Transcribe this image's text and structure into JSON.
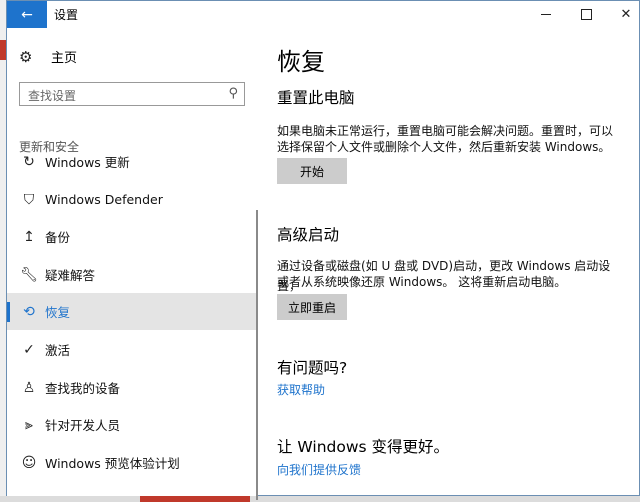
{
  "window": {
    "title": "设置",
    "back_icon": "arrow-left-icon"
  },
  "sidebar": {
    "home_label": "主页",
    "search_placeholder": "查找设置",
    "section_title": "更新和安全",
    "items": [
      {
        "label": "Windows 更新",
        "icon": "sync-icon"
      },
      {
        "label": "Windows Defender",
        "icon": "shield-icon"
      },
      {
        "label": "备份",
        "icon": "upload-arrow-icon"
      },
      {
        "label": "疑难解答",
        "icon": "wrench-icon"
      },
      {
        "label": "恢复",
        "icon": "history-icon",
        "active": true
      },
      {
        "label": "激活",
        "icon": "check-circle-icon"
      },
      {
        "label": "查找我的设备",
        "icon": "person-icon"
      },
      {
        "label": "针对开发人员",
        "icon": "developer-icon"
      },
      {
        "label": "Windows 预览体验计划",
        "icon": "smiley-icon"
      }
    ]
  },
  "content": {
    "page_title": "恢复",
    "reset": {
      "heading": "重置此电脑",
      "line1": "如果电脑未正常运行，重置电脑可能会解决问题。重置时，可以",
      "line2": "选择保留个人文件或删除个人文件，然后重新安装 Windows。",
      "button": "开始"
    },
    "advanced": {
      "heading": "高级启动",
      "line1": "通过设备或磁盘(如 U 盘或 DVD)启动，更改 Windows 启动设置，",
      "line2": "或者从系统映像还原 Windows。 这将重新启动电脑。",
      "button": "立即重启"
    },
    "question": {
      "heading": "有问题吗?",
      "link": "获取帮助"
    },
    "better": {
      "heading": "让 Windows 变得更好。",
      "link": "向我们提供反馈"
    }
  },
  "colors": {
    "accent": "#1e73cc",
    "button_bg": "#cccccc",
    "active_bg": "#e4e4e4"
  }
}
